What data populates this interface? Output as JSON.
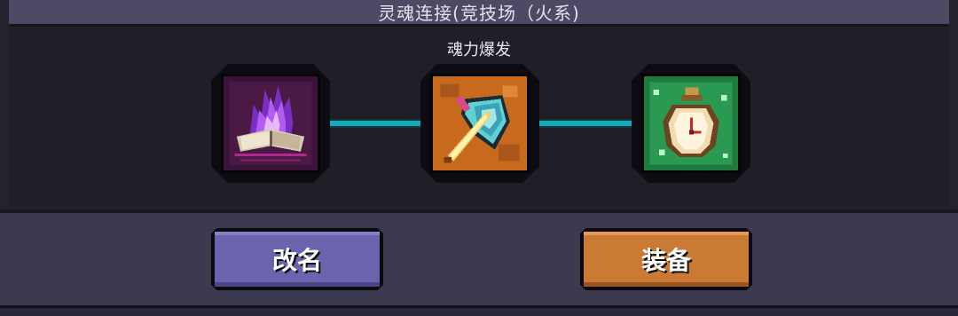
{
  "header": {
    "title": "灵魂连接(竞技场（火系)"
  },
  "skill_chain": {
    "active_label": "魂力爆发",
    "slots": [
      {
        "icon": "purple-flame-book-icon",
        "accent": "#8a3fd6",
        "frame": "#3a1438"
      },
      {
        "icon": "crystal-shield-sword-icon",
        "accent": "#5fd0d4",
        "frame": "#c86a1e"
      },
      {
        "icon": "clock-potion-icon",
        "accent": "#e7c07a",
        "frame": "#1e7a3e"
      }
    ],
    "connector_color": "#1aa6b7"
  },
  "actions": {
    "rename_label": "改名",
    "equip_label": "装备"
  },
  "colors": {
    "rename_button": "#6a64ae",
    "equip_button": "#cb7a34",
    "panel": "#1f1f28",
    "header": "#4c4a64"
  }
}
